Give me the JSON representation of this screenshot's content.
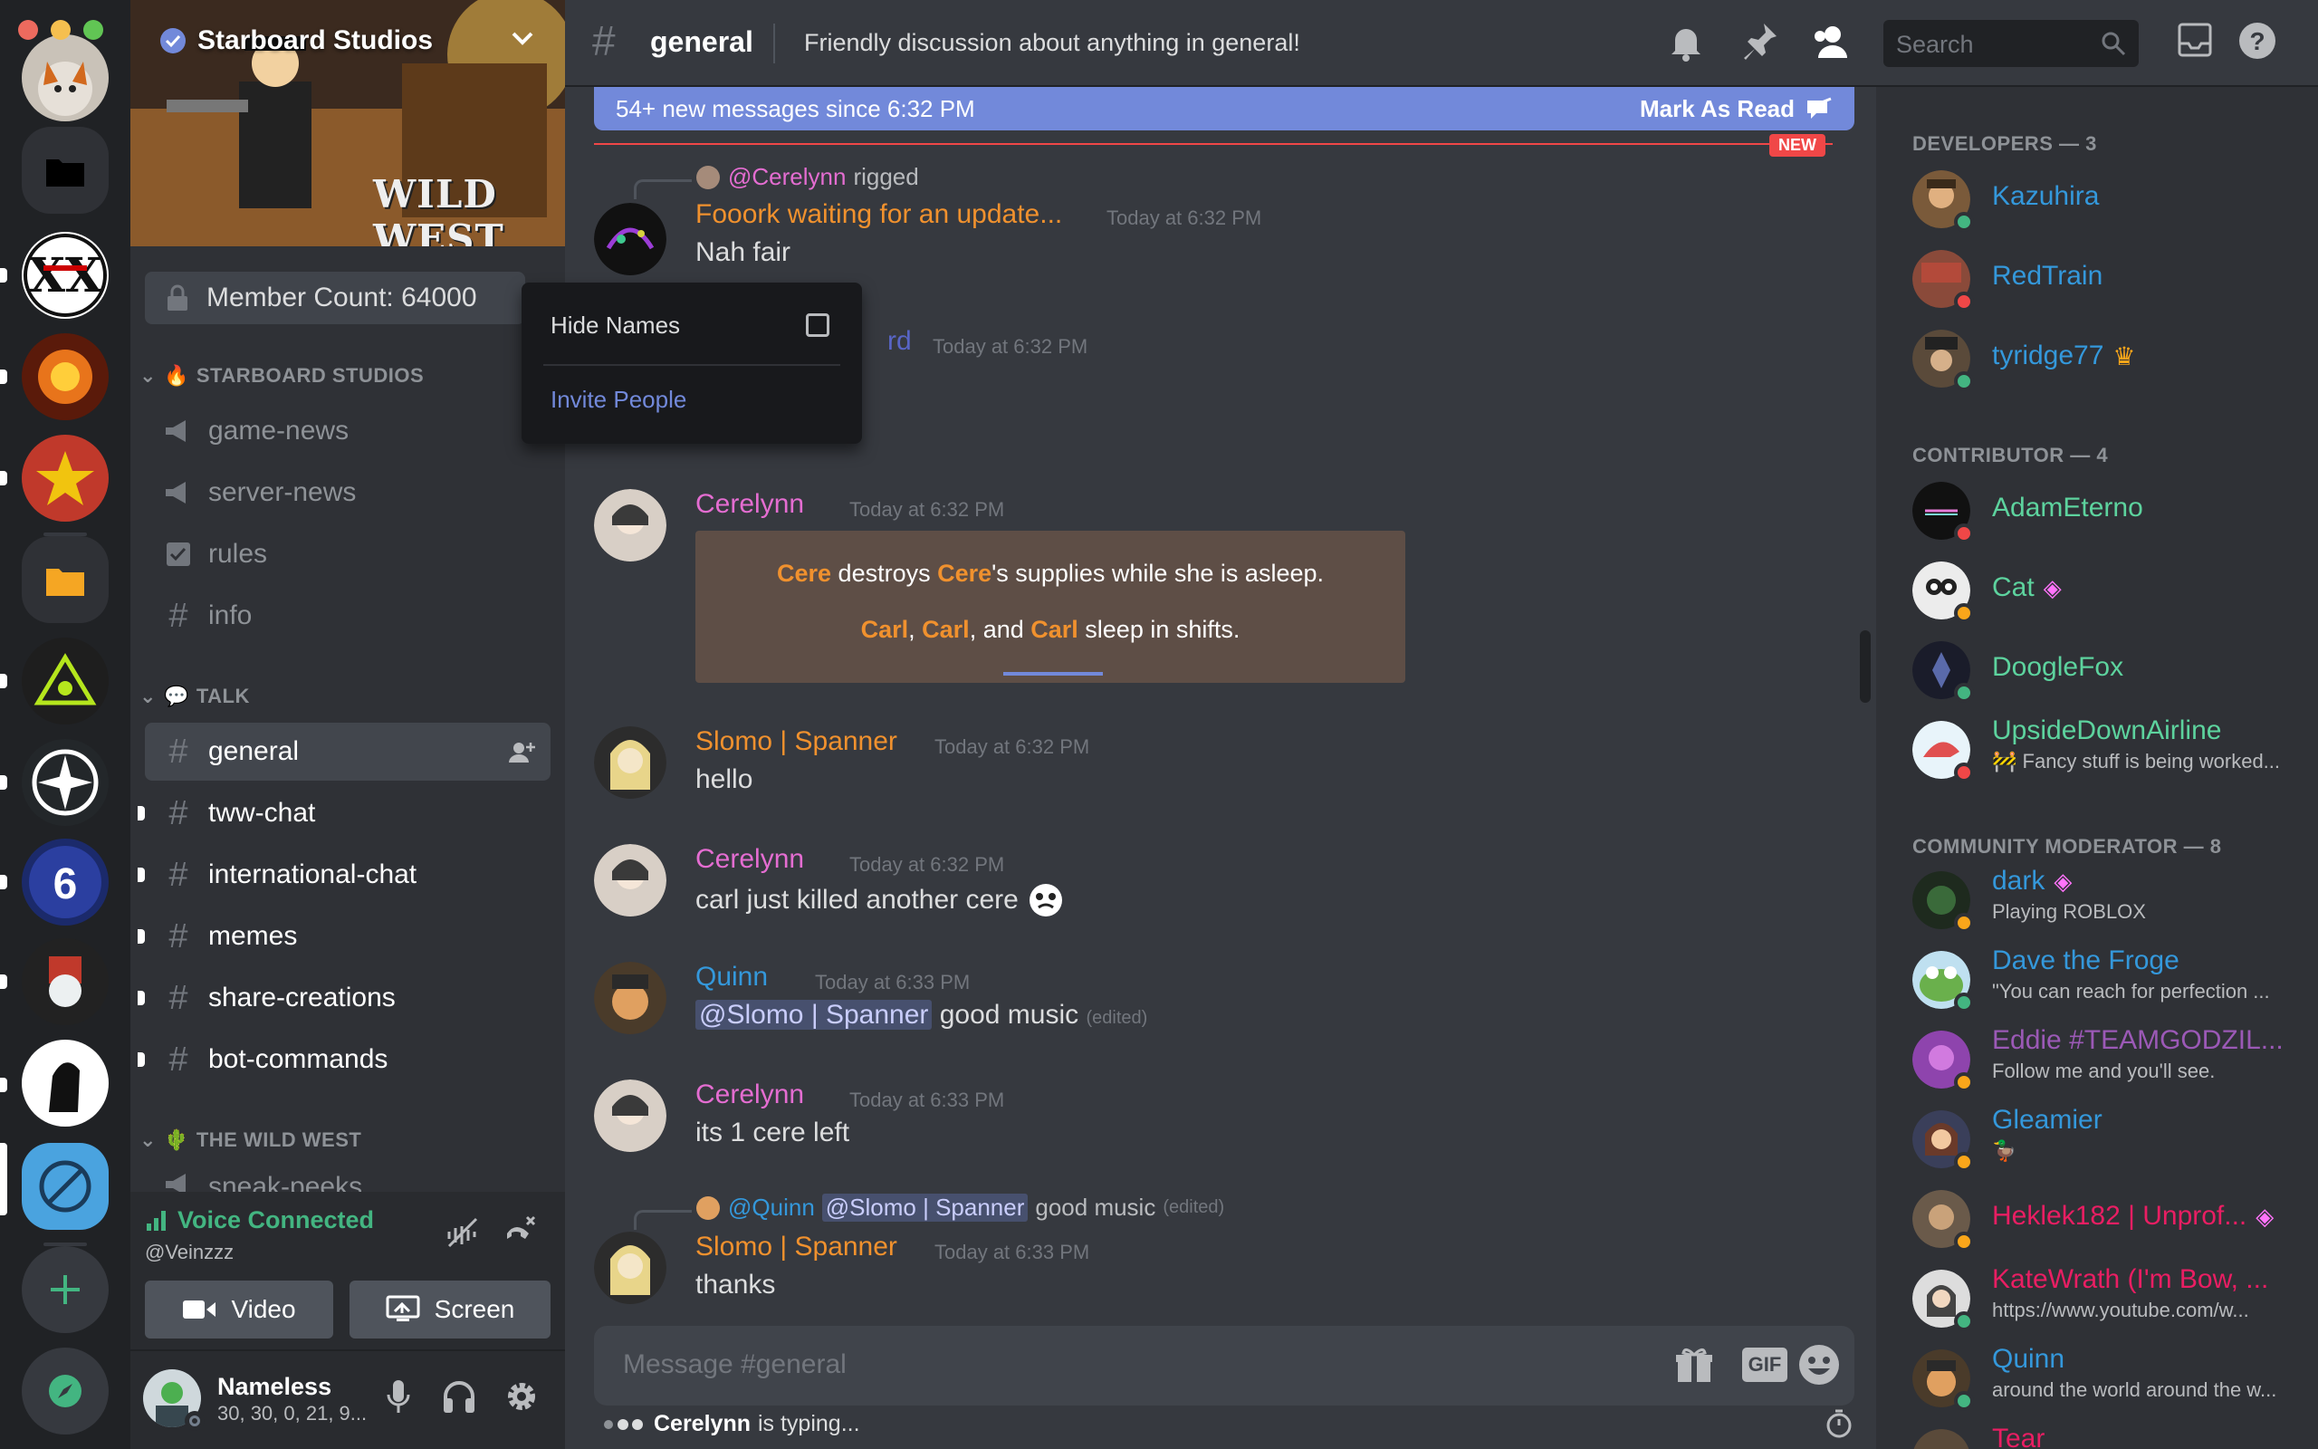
{
  "window": {
    "traffic_lights": [
      "#ed6a5e",
      "#f5bf4f",
      "#61c554"
    ]
  },
  "server": {
    "name": "Starboard Studios",
    "banner_text": "WILD WEST",
    "member_count": "Member Count: 64000"
  },
  "dropdown": {
    "hide_names": "Hide Names",
    "invite": "Invite People"
  },
  "categories": [
    {
      "label": "STARBOARD STUDIOS",
      "emoji": "🔥"
    },
    {
      "label": "TALK",
      "emoji": "💬"
    },
    {
      "label": "THE WILD WEST",
      "emoji": "🌵"
    }
  ],
  "channels": {
    "announcements": [
      {
        "name": "game-news",
        "icon": "megaphone-icon"
      },
      {
        "name": "server-news",
        "icon": "megaphone-icon"
      },
      {
        "name": "rules",
        "icon": "checkbox-icon"
      },
      {
        "name": "info",
        "icon": "hash-icon"
      }
    ],
    "talk": [
      "general",
      "tww-chat",
      "international-chat",
      "memes",
      "share-creations",
      "bot-commands"
    ],
    "wildwest": [
      "sneak-peeks"
    ]
  },
  "voice": {
    "status": "Voice Connected",
    "user": "@Veinzzz",
    "video": "Video",
    "screen": "Screen"
  },
  "current_user": {
    "name": "Nameless",
    "status": "30, 30, 0, 21, 9..."
  },
  "header": {
    "channel": "general",
    "topic": "Friendly discussion about anything in general!",
    "search_placeholder": "Search"
  },
  "new_messages": {
    "text": "54+ new messages since 6:32 PM",
    "mark": "Mark As Read",
    "tag": "NEW"
  },
  "messages": [
    {
      "reply_user": "@Cerelynn",
      "reply_text": "rigged",
      "user": "Fooork waiting for an update...",
      "time": "Today at 6:32 PM",
      "text": "Nah fair",
      "color": "#f0912e"
    },
    {
      "user_fragment": "rd",
      "time": "Today at 6:32 PM"
    },
    {
      "user": "Cerelynn",
      "time": "Today at 6:32 PM",
      "color": "#e46dd1",
      "embed": {
        "l1a": "Cere",
        "l1b": " destroys ",
        "l1c": "Cere",
        "l1d": "'s supplies while she is asleep.",
        "l2a": "Carl",
        "l2b": ", ",
        "l2c": "Carl",
        "l2d": ", and ",
        "l2e": "Carl",
        "l2f": " sleep in shifts."
      }
    },
    {
      "user": "Slomo | Spanner",
      "time": "Today at 6:32 PM",
      "text": "hello",
      "color": "#f0912e"
    },
    {
      "user": "Cerelynn",
      "time": "Today at 6:32 PM",
      "text": "carl just killed another cere",
      "color": "#e46dd1"
    },
    {
      "user": "Quinn",
      "time": "Today at 6:33 PM",
      "mention": "@Slomo | Spanner",
      "text": "good music",
      "edited": "(edited)",
      "color": "#3498db"
    },
    {
      "user": "Cerelynn",
      "time": "Today at 6:33 PM",
      "text": "its 1 cere left",
      "color": "#e46dd1"
    },
    {
      "reply_user": "@Quinn",
      "reply_mention": "@Slomo | Spanner",
      "reply_text": "good music",
      "reply_edited": "(edited)",
      "user": "Slomo | Spanner",
      "time": "Today at 6:33 PM",
      "text": "thanks",
      "color": "#f0912e"
    }
  ],
  "composer": {
    "placeholder": "Message #general",
    "gif": "GIF"
  },
  "typing": {
    "user": "Cerelynn",
    "suffix": "is typing..."
  },
  "member_groups": [
    {
      "label": "DEVELOPERS — 3",
      "members": [
        {
          "name": "Kazuhira",
          "color": "#3498db",
          "status": "online"
        },
        {
          "name": "RedTrain",
          "color": "#3498db",
          "status": "dnd"
        },
        {
          "name": "tyridge77",
          "color": "#3498db",
          "status": "online",
          "crown": "♛"
        }
      ]
    },
    {
      "label": "CONTRIBUTOR — 4",
      "members": [
        {
          "name": "AdamEterno",
          "color": "#5dd39e",
          "status": "dnd"
        },
        {
          "name": "Cat",
          "color": "#5dd39e",
          "status": "idle",
          "badge": "◈"
        },
        {
          "name": "DoogleFox",
          "color": "#5dd39e",
          "status": "online"
        },
        {
          "name": "UpsideDownAirline",
          "color": "#5dd39e",
          "status": "dnd",
          "sub": "Fancy stuff is being worked..."
        }
      ]
    },
    {
      "label": "COMMUNITY MODERATOR — 8",
      "members": [
        {
          "name": "dark",
          "color": "#3498db",
          "status": "idle",
          "badge": "◈",
          "sub": "Playing ROBLOX"
        },
        {
          "name": "Dave the Froge",
          "color": "#3498db",
          "status": "online",
          "sub": "\"You can reach for perfection ..."
        },
        {
          "name": "Eddie #TEAMGODZIL...",
          "color": "#9b59b6",
          "status": "idle",
          "sub": "Follow me and you'll see."
        },
        {
          "name": "Gleamier",
          "color": "#3498db",
          "status": "idle",
          "sub": "🦆"
        },
        {
          "name": "Heklek182 | Unprof...",
          "color": "#e91e63",
          "status": "idle",
          "badge": "◈"
        },
        {
          "name": "KateWrath (I'm Bow, ...",
          "color": "#e91e63",
          "status": "online",
          "sub": "https://www.youtube.com/w..."
        },
        {
          "name": "Quinn",
          "color": "#3498db",
          "status": "online",
          "sub": "around the world around the w..."
        },
        {
          "name": "Tear",
          "color": "#e91e63",
          "status": "online"
        }
      ]
    }
  ],
  "colors": {
    "online": "#43b581",
    "idle": "#faa61a",
    "dnd": "#f04747",
    "blurple": "#7289da"
  }
}
